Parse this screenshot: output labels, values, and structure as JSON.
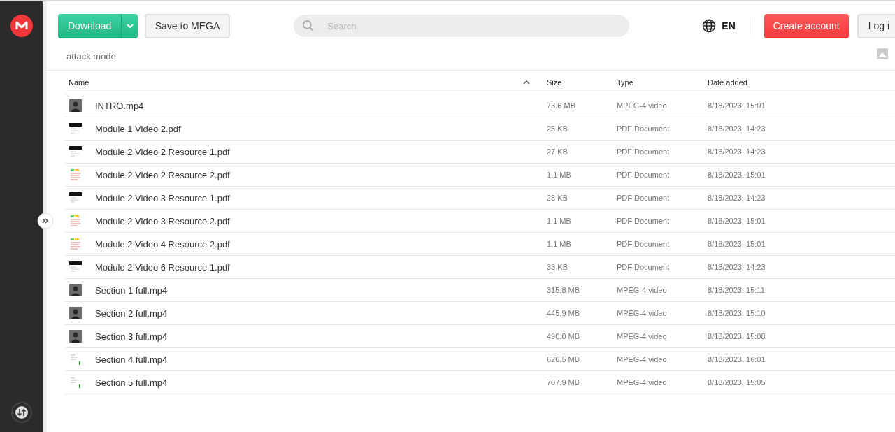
{
  "header": {
    "download_button": "Download",
    "save_button": "Save to MEGA",
    "search": {
      "placeholder": "Search"
    },
    "language": "EN",
    "create_account_button": "Create account",
    "login_button": "Log i"
  },
  "folder": {
    "name": "attack mode"
  },
  "table": {
    "columns": [
      {
        "label": "Name",
        "sorted": true
      },
      {
        "label": "Size",
        "sorted": false
      },
      {
        "label": "Type",
        "sorted": false
      },
      {
        "label": "Date added",
        "sorted": false
      }
    ],
    "rows": [
      {
        "kind": "video",
        "name": "INTRO.mp4",
        "size": "73.6 MB",
        "type": "MPEG-4 video",
        "date": "8/18/2023, 15:01"
      },
      {
        "kind": "pdf",
        "name": "Module 1 Video 2.pdf",
        "size": "25 KB",
        "type": "PDF Document",
        "date": "8/18/2023, 14:23"
      },
      {
        "kind": "pdf",
        "name": "Module 2 Video 2 Resource 1.pdf",
        "size": "27 KB",
        "type": "PDF Document",
        "date": "8/18/2023, 14:23"
      },
      {
        "kind": "doc",
        "name": "Module 2 Video 2 Resource 2.pdf",
        "size": "1.1 MB",
        "type": "PDF Document",
        "date": "8/18/2023, 15:01"
      },
      {
        "kind": "pdf",
        "name": "Module 2 Video 3 Resource 1.pdf",
        "size": "28 KB",
        "type": "PDF Document",
        "date": "8/18/2023, 14:23"
      },
      {
        "kind": "doc",
        "name": "Module 2 Video 3 Resource 2.pdf",
        "size": "1.1 MB",
        "type": "PDF Document",
        "date": "8/18/2023, 15:01"
      },
      {
        "kind": "doc",
        "name": "Module 2 Video 4 Resource 2.pdf",
        "size": "1.1 MB",
        "type": "PDF Document",
        "date": "8/18/2023, 15:01"
      },
      {
        "kind": "pdf",
        "name": "Module 2 Video 6 Resource 1.pdf",
        "size": "33 KB",
        "type": "PDF Document",
        "date": "8/18/2023, 14:23"
      },
      {
        "kind": "video",
        "name": "Section 1 full.mp4",
        "size": "315.8 MB",
        "type": "MPEG-4 video",
        "date": "8/18/2023, 15:11"
      },
      {
        "kind": "video",
        "name": "Section 2 full.mp4",
        "size": "445.9 MB",
        "type": "MPEG-4 video",
        "date": "8/18/2023, 15:10"
      },
      {
        "kind": "video",
        "name": "Section 3 full.mp4",
        "size": "490.0 MB",
        "type": "MPEG-4 video",
        "date": "8/18/2023, 15:08"
      },
      {
        "kind": "screen",
        "name": "Section 4 full.mp4",
        "size": "626.5 MB",
        "type": "MPEG-4 video",
        "date": "8/18/2023, 16:01"
      },
      {
        "kind": "screen",
        "name": "Section 5 full.mp4",
        "size": "707.9 MB",
        "type": "MPEG-4 video",
        "date": "8/18/2023, 15:05"
      }
    ]
  }
}
